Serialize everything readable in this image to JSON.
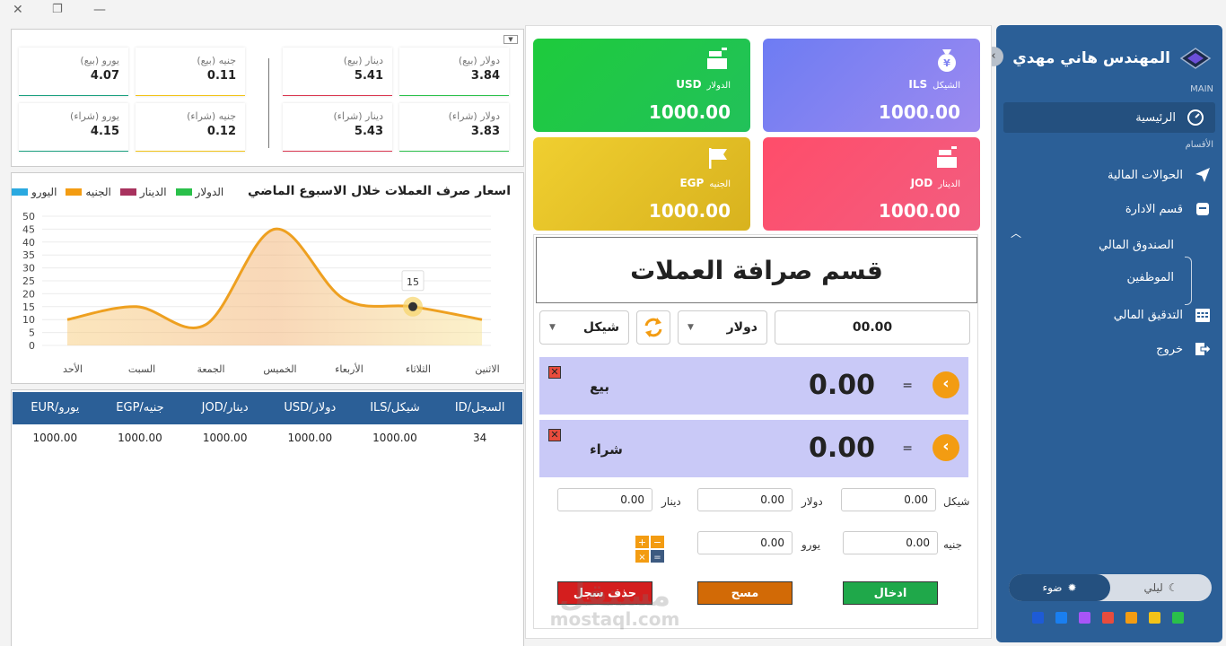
{
  "window": {
    "close": "✕",
    "restore": "❐",
    "minimize": "—"
  },
  "sidebar": {
    "brand": "المهندس هاني مهدي",
    "section_main": "MAIN",
    "section_departments": "الأقسام",
    "nav": {
      "home": "الرئيسية",
      "transfers": "الحوالات المالية",
      "admin": "قسم الادارة",
      "fund": "الصندوق المالي",
      "employees": "الموظفين",
      "audit": "التدقيق المالي",
      "logout": "خروج"
    },
    "theme": {
      "night": "ليلي",
      "light": "ضوء"
    },
    "swatches": [
      "#2ac04a",
      "#f2c318",
      "#f39c12",
      "#e84c3d",
      "#a855f7",
      "#1a7ff0",
      "#1e5bd6"
    ]
  },
  "cards": {
    "usd": {
      "code": "USD",
      "name": "الدولار",
      "value": "1000.00"
    },
    "ils": {
      "code": "ILS",
      "name": "الشيكل",
      "value": "1000.00"
    },
    "egp": {
      "code": "EGP",
      "name": "الجنيه",
      "value": "1000.00"
    },
    "jod": {
      "code": "JOD",
      "name": "الدينار",
      "value": "1000.00"
    }
  },
  "exchange": {
    "title": "قسم صرافة العملات",
    "amount": "00.00",
    "from_currency": "دولار",
    "to_currency": "شيكل",
    "sell_label": "بيع",
    "sell_value": "0.00",
    "buy_label": "شراء",
    "buy_value": "0.00",
    "equals": "=",
    "x_mark": "✕",
    "inputs": {
      "shekel_label": "شيكل",
      "shekel_value": "0.00",
      "dollar_label": "دولار",
      "dollar_value": "0.00",
      "dinar_label": "دينار",
      "dinar_value": "0.00",
      "pound_label": "جنيه",
      "pound_value": "0.00",
      "euro_label": "يورو",
      "euro_value": "0.00"
    },
    "buttons": {
      "enter": "ادخال",
      "clear": "مسح",
      "delete": "حذف سجل"
    }
  },
  "rates": {
    "dollar_sell": {
      "label": "دولار (بيع)",
      "value": "3.84"
    },
    "dollar_buy": {
      "label": "دولار (شراء)",
      "value": "3.83"
    },
    "dinar_sell": {
      "label": "دينار (بيع)",
      "value": "5.41"
    },
    "dinar_buy": {
      "label": "دينار (شراء)",
      "value": "5.43"
    },
    "pound_sell": {
      "label": "جنيه (بيع)",
      "value": "0.11"
    },
    "pound_buy": {
      "label": "جنيه (شراء)",
      "value": "0.12"
    },
    "euro_sell": {
      "label": "يورو (بيع)",
      "value": "4.07"
    },
    "euro_buy": {
      "label": "يورو (شراء)",
      "value": "4.15"
    }
  },
  "chart_data": {
    "type": "area",
    "title": "اسعار صرف العملات خلال الاسبوع الماضي",
    "legend": [
      "الدولار",
      "الدينار",
      "الجنيه",
      "اليورو"
    ],
    "legend_colors": [
      "#2ac04a",
      "#a8325e",
      "#f39c12",
      "#2aa9e0"
    ],
    "categories": [
      "الأحد",
      "السبت",
      "الجمعة",
      "الخميس",
      "الأربعاء",
      "الثلاثاء",
      "الاثنين"
    ],
    "series": [
      {
        "name": "الجنيه",
        "values": [
          10,
          15,
          8,
          45,
          18,
          15,
          10
        ]
      }
    ],
    "ylim": [
      0,
      50
    ],
    "yticks": [
      0,
      5,
      10,
      15,
      20,
      25,
      30,
      35,
      40,
      45,
      50
    ],
    "tooltip": {
      "category": "الثلاثاء",
      "value": "15"
    }
  },
  "table": {
    "headers": [
      "السجل/ID",
      "شيكل/ILS",
      "دولار/USD",
      "دينار/JOD",
      "جنيه/EGP",
      "يورو/EUR"
    ],
    "rows": [
      [
        "34",
        "1000.00",
        "1000.00",
        "1000.00",
        "1000.00",
        "1000.00"
      ]
    ]
  },
  "watermark": {
    "line1": "مستقل",
    "line2": "mostaql.com"
  }
}
